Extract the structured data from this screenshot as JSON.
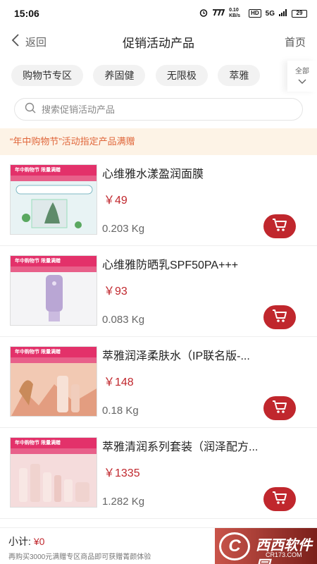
{
  "status_bar": {
    "time": "15:06",
    "net_speed": "0.10 KB/s",
    "hd": "HD",
    "signal": "5G",
    "battery": "29"
  },
  "header": {
    "back_label": "返回",
    "title": "促销活动产品",
    "home_label": "首页"
  },
  "tabs": {
    "items": [
      "购物节专区",
      "养固健",
      "无限极",
      "萃雅"
    ],
    "all_label": "全部"
  },
  "search": {
    "placeholder": "搜索促销活动产品"
  },
  "promo_banner": "“年中购物节”活动指定产品满赠",
  "products": [
    {
      "name": "心维雅水漾盈润面膜",
      "price": "￥49",
      "weight": "0.203 Kg",
      "thumb_banner": "年中购物节 限量满赠"
    },
    {
      "name": "心维雅防晒乳SPF50PA+++",
      "price": "￥93",
      "weight": "0.083 Kg",
      "thumb_banner": "年中购物节 限量满赠"
    },
    {
      "name": "萃雅润泽柔肤水（IP联名版-...",
      "price": "￥148",
      "weight": "0.18 Kg",
      "thumb_banner": "年中购物节 限量满赠"
    },
    {
      "name": "萃雅清润系列套装（润泽配方...",
      "price": "￥1335",
      "weight": "1.282 Kg",
      "thumb_banner": "年中购物节 限量满赠"
    }
  ],
  "footer": {
    "subtotal_label": "小计:",
    "subtotal_value": "¥0",
    "tip": "再购买3000元满赠专区商品即可获赠菁颜体验"
  },
  "watermark": {
    "text": "西西软件园",
    "sub": "CR173.COM",
    "badge": "C"
  },
  "colors": {
    "accent": "#c0272d",
    "promo_bg": "#fdf3e6",
    "promo_text": "#e0663a"
  }
}
